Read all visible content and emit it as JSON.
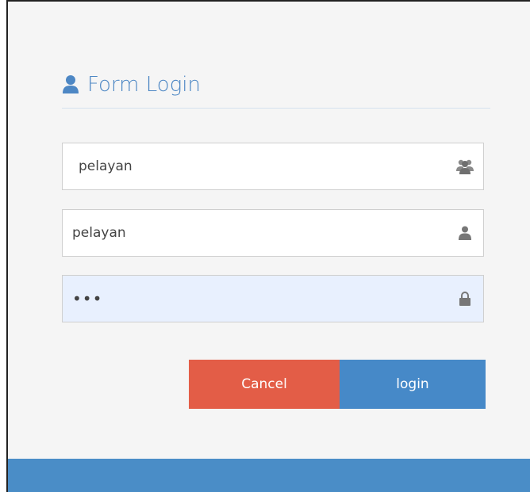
{
  "form": {
    "title": "Form Login",
    "fields": [
      {
        "value": "pelayan",
        "icon": "users-icon"
      },
      {
        "value": "pelayan",
        "icon": "user-icon"
      },
      {
        "value": "•••",
        "icon": "lock-icon"
      }
    ]
  },
  "buttons": {
    "cancel_label": "Cancel",
    "login_label": "login"
  },
  "colors": {
    "accent": "#4d87c4",
    "cancel": "#e35d47",
    "login": "#4689c8",
    "autofill": "#e8f0fe",
    "footer": "#4a8dc7"
  }
}
